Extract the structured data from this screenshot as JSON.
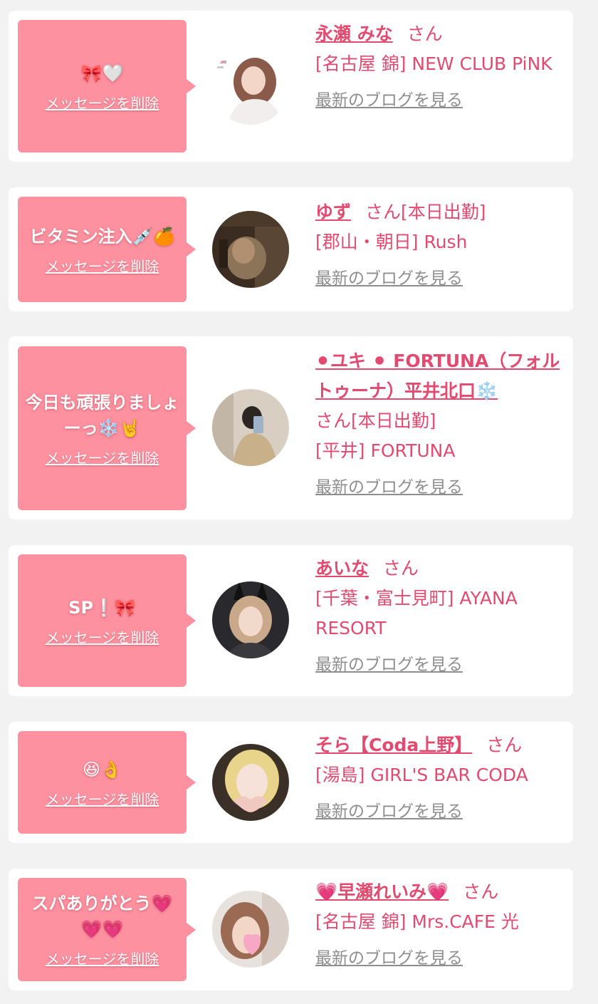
{
  "delete_label": "メッセージを削除",
  "blog_label": "最新のブログを見る",
  "colors": {
    "bubble": "#fe919f",
    "accent": "#e34a6f",
    "link_gray": "#8e8e8e",
    "background": "#f2f2f2",
    "card": "#ffffff"
  },
  "items": [
    {
      "message": "🎀🤍",
      "name": "永瀬 みな",
      "suffix": "さん",
      "shop": "[名古屋 錦] NEW CLUB PiNK",
      "avatar": "profile-photo"
    },
    {
      "message": "ビタミン注入💉🍊",
      "name": "ゆず",
      "suffix": "さん[本日出勤]",
      "shop": "[郡山・朝日] Rush",
      "avatar": "profile-photo"
    },
    {
      "message": "今日も頑張りましょーっ❄️🤘",
      "name": "⚫︎ユキ ⚫︎ FORTUNA（フォルトゥーナ）平井北口❄️",
      "suffix": "さん[本日出勤]",
      "shop": "[平井] FORTUNA",
      "avatar": "profile-photo"
    },
    {
      "message": "SP❕🎀",
      "name": "あいな",
      "suffix": "さん",
      "shop": "[千葉・富士見町] AYANA RESORT",
      "avatar": "profile-photo"
    },
    {
      "message": "😆👌",
      "name": "そら【Coda上野】",
      "suffix": "さん",
      "shop": "[湯島] GIRL'S BAR CODA",
      "avatar": "profile-photo"
    },
    {
      "message": "スパありがとう💗💗💗",
      "name": "💗早瀬れいみ💗",
      "suffix": "さん",
      "shop": "[名古屋 錦] Mrs.CAFE 光",
      "avatar": "profile-photo"
    }
  ]
}
